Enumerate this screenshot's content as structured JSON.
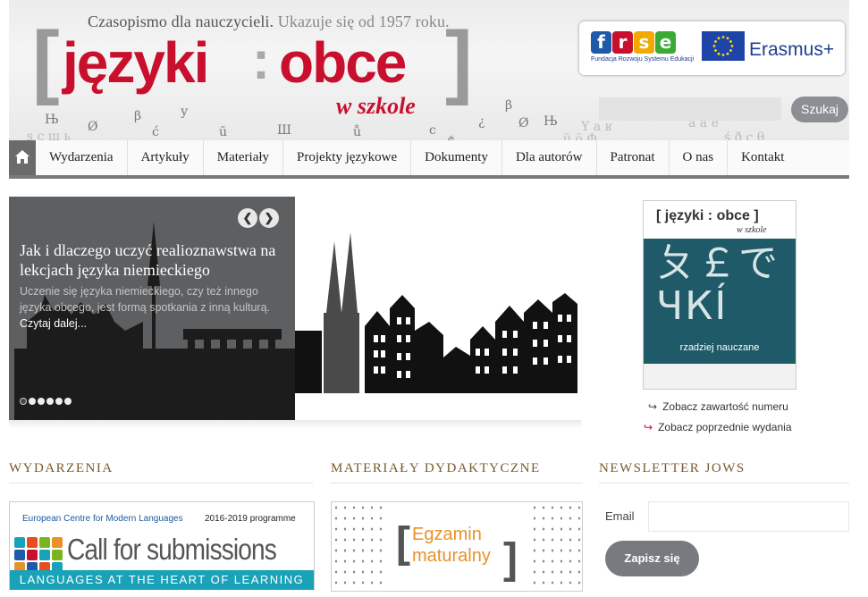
{
  "header": {
    "tagline_main": "Czasopismo dla nauczycieli.",
    "tagline_sub": "Ukazuje się od 1957 roku.",
    "logo_word1": "języki",
    "logo_word2": "obce",
    "logo_sub": "w szkole",
    "partner_frse_letters": [
      "f",
      "r",
      "s",
      "e"
    ],
    "partner_frse_caption": "Fundacja Rozwoju Systemu Edukacji",
    "partner_erasmus": "Erasmus+",
    "search_button": "Szukaj",
    "search_placeholder": ""
  },
  "nav": {
    "items": [
      "Wydarzenia",
      "Artykuły",
      "Materiały",
      "Projekty językowe",
      "Dokumenty",
      "Dla autorów",
      "Patronat",
      "O nas",
      "Kontakt"
    ]
  },
  "slider": {
    "title": "Jak i dlaczego uczyć realioznawstwa na lekcjach języka niemieckiego",
    "description": "Uczenie się języka niemieckiego, czy też innego języka obcego, jest formą spotkania z inną kulturą.",
    "more": "Czytaj dalej...",
    "slide_count": 6,
    "active_slide": 1
  },
  "cover": {
    "logo": "[ języki : obce ]",
    "logo_sub": "w szkole",
    "big_text_line1": "ㄆ￡で",
    "big_text_line2": "ЧКÍ",
    "caption": "rzadziej nauczane"
  },
  "issue_links": {
    "contents": "Zobacz zawartość numeru",
    "previous": "Zobacz poprzednie wydania"
  },
  "sections": {
    "events_title": "WYDARZENIA",
    "materials_title": "MATERIAŁY DYDAKTYCZNE",
    "newsletter_title": "NEWSLETTER JOWS"
  },
  "ecml_banner": {
    "org": "European Centre for Modern Languages",
    "years": "2016-2019 programme",
    "headline": "Call for submissions",
    "band": "LANGUAGES AT THE HEART OF LEARNING"
  },
  "materials_banner": {
    "line1": "Egzamin",
    "line2": "maturalny"
  },
  "newsletter": {
    "email_label": "Email",
    "email_value": "",
    "submit": "Zapisz się"
  },
  "colors": {
    "brand_red": "#c8102e",
    "section_title": "#7a5a2e",
    "button_grey": "#777b7f",
    "ecml_band": "#1aa3b8",
    "egzamin_orange": "#e8912a"
  }
}
